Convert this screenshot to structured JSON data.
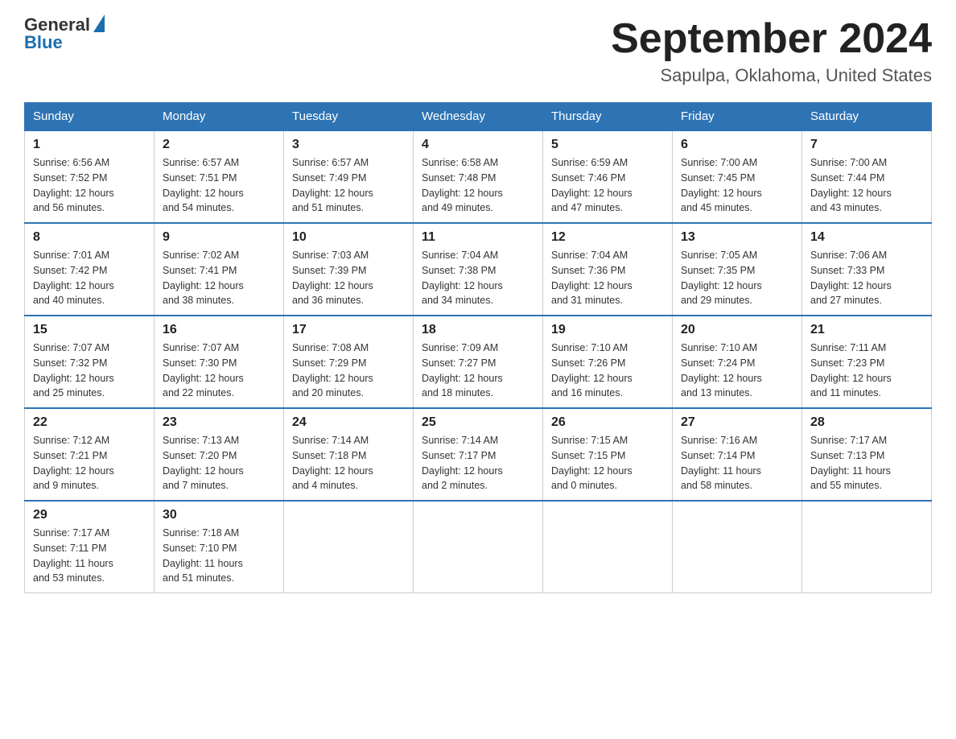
{
  "header": {
    "logo_general": "General",
    "logo_blue": "Blue",
    "title": "September 2024",
    "subtitle": "Sapulpa, Oklahoma, United States"
  },
  "days_of_week": [
    "Sunday",
    "Monday",
    "Tuesday",
    "Wednesday",
    "Thursday",
    "Friday",
    "Saturday"
  ],
  "weeks": [
    [
      {
        "day": "1",
        "sunrise": "6:56 AM",
        "sunset": "7:52 PM",
        "daylight": "12 hours and 56 minutes."
      },
      {
        "day": "2",
        "sunrise": "6:57 AM",
        "sunset": "7:51 PM",
        "daylight": "12 hours and 54 minutes."
      },
      {
        "day": "3",
        "sunrise": "6:57 AM",
        "sunset": "7:49 PM",
        "daylight": "12 hours and 51 minutes."
      },
      {
        "day": "4",
        "sunrise": "6:58 AM",
        "sunset": "7:48 PM",
        "daylight": "12 hours and 49 minutes."
      },
      {
        "day": "5",
        "sunrise": "6:59 AM",
        "sunset": "7:46 PM",
        "daylight": "12 hours and 47 minutes."
      },
      {
        "day": "6",
        "sunrise": "7:00 AM",
        "sunset": "7:45 PM",
        "daylight": "12 hours and 45 minutes."
      },
      {
        "day": "7",
        "sunrise": "7:00 AM",
        "sunset": "7:44 PM",
        "daylight": "12 hours and 43 minutes."
      }
    ],
    [
      {
        "day": "8",
        "sunrise": "7:01 AM",
        "sunset": "7:42 PM",
        "daylight": "12 hours and 40 minutes."
      },
      {
        "day": "9",
        "sunrise": "7:02 AM",
        "sunset": "7:41 PM",
        "daylight": "12 hours and 38 minutes."
      },
      {
        "day": "10",
        "sunrise": "7:03 AM",
        "sunset": "7:39 PM",
        "daylight": "12 hours and 36 minutes."
      },
      {
        "day": "11",
        "sunrise": "7:04 AM",
        "sunset": "7:38 PM",
        "daylight": "12 hours and 34 minutes."
      },
      {
        "day": "12",
        "sunrise": "7:04 AM",
        "sunset": "7:36 PM",
        "daylight": "12 hours and 31 minutes."
      },
      {
        "day": "13",
        "sunrise": "7:05 AM",
        "sunset": "7:35 PM",
        "daylight": "12 hours and 29 minutes."
      },
      {
        "day": "14",
        "sunrise": "7:06 AM",
        "sunset": "7:33 PM",
        "daylight": "12 hours and 27 minutes."
      }
    ],
    [
      {
        "day": "15",
        "sunrise": "7:07 AM",
        "sunset": "7:32 PM",
        "daylight": "12 hours and 25 minutes."
      },
      {
        "day": "16",
        "sunrise": "7:07 AM",
        "sunset": "7:30 PM",
        "daylight": "12 hours and 22 minutes."
      },
      {
        "day": "17",
        "sunrise": "7:08 AM",
        "sunset": "7:29 PM",
        "daylight": "12 hours and 20 minutes."
      },
      {
        "day": "18",
        "sunrise": "7:09 AM",
        "sunset": "7:27 PM",
        "daylight": "12 hours and 18 minutes."
      },
      {
        "day": "19",
        "sunrise": "7:10 AM",
        "sunset": "7:26 PM",
        "daylight": "12 hours and 16 minutes."
      },
      {
        "day": "20",
        "sunrise": "7:10 AM",
        "sunset": "7:24 PM",
        "daylight": "12 hours and 13 minutes."
      },
      {
        "day": "21",
        "sunrise": "7:11 AM",
        "sunset": "7:23 PM",
        "daylight": "12 hours and 11 minutes."
      }
    ],
    [
      {
        "day": "22",
        "sunrise": "7:12 AM",
        "sunset": "7:21 PM",
        "daylight": "12 hours and 9 minutes."
      },
      {
        "day": "23",
        "sunrise": "7:13 AM",
        "sunset": "7:20 PM",
        "daylight": "12 hours and 7 minutes."
      },
      {
        "day": "24",
        "sunrise": "7:14 AM",
        "sunset": "7:18 PM",
        "daylight": "12 hours and 4 minutes."
      },
      {
        "day": "25",
        "sunrise": "7:14 AM",
        "sunset": "7:17 PM",
        "daylight": "12 hours and 2 minutes."
      },
      {
        "day": "26",
        "sunrise": "7:15 AM",
        "sunset": "7:15 PM",
        "daylight": "12 hours and 0 minutes."
      },
      {
        "day": "27",
        "sunrise": "7:16 AM",
        "sunset": "7:14 PM",
        "daylight": "11 hours and 58 minutes."
      },
      {
        "day": "28",
        "sunrise": "7:17 AM",
        "sunset": "7:13 PM",
        "daylight": "11 hours and 55 minutes."
      }
    ],
    [
      {
        "day": "29",
        "sunrise": "7:17 AM",
        "sunset": "7:11 PM",
        "daylight": "11 hours and 53 minutes."
      },
      {
        "day": "30",
        "sunrise": "7:18 AM",
        "sunset": "7:10 PM",
        "daylight": "11 hours and 51 minutes."
      },
      null,
      null,
      null,
      null,
      null
    ]
  ],
  "labels": {
    "sunrise": "Sunrise:",
    "sunset": "Sunset:",
    "daylight": "Daylight:"
  }
}
